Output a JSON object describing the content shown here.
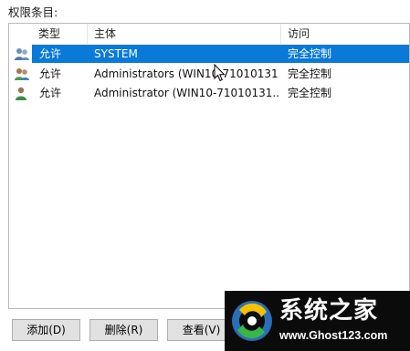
{
  "section_label": "权限条目:",
  "columns": [
    "类型",
    "主体",
    "访问"
  ],
  "rows": [
    {
      "icon": "users-group-icon",
      "type": "允许",
      "principal": "SYSTEM",
      "access": "完全控制",
      "selected": true
    },
    {
      "icon": "users-group-icon",
      "type": "允许",
      "principal": "Administrators (WIN10-71010131...",
      "access": "完全控制",
      "selected": false
    },
    {
      "icon": "user-icon",
      "type": "允许",
      "principal": "Administrator (WIN10-71010131...",
      "access": "完全控制",
      "selected": false
    }
  ],
  "buttons": {
    "add": "添加(D)",
    "remove": "删除(R)",
    "view": "查看(V)"
  },
  "watermark": {
    "title": "系统之家",
    "url": "www.Ghost123.com"
  },
  "colors": {
    "selection": "#0a79d8",
    "button_bg": "#e1e1e1",
    "border": "#b9b9b9"
  }
}
